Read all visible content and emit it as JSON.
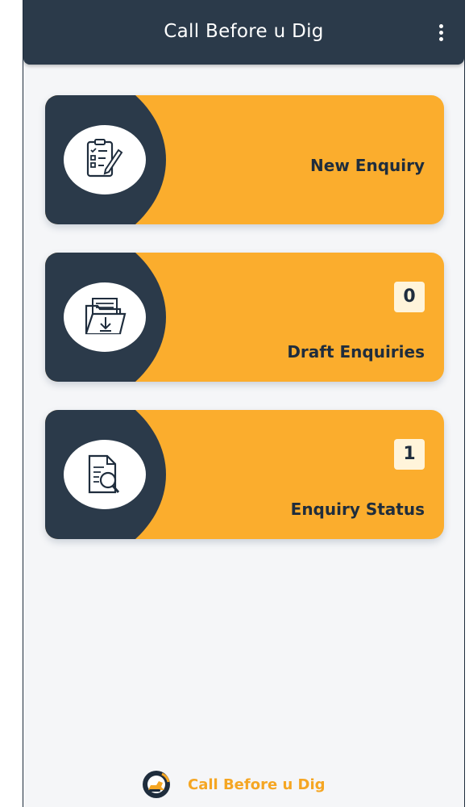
{
  "app": {
    "title": "Call Before u Dig",
    "menu_icon": "more-vertical-icon"
  },
  "colors": {
    "header": "#2b3a4a",
    "accent": "#fbad2d",
    "background": "#f5f6f8",
    "footer_text": "#f5a623"
  },
  "cards": [
    {
      "label": "New Enquiry",
      "icon": "checklist-pen-icon"
    },
    {
      "label": "Draft Enquiries",
      "count": "0",
      "icon": "folder-download-icon"
    },
    {
      "label": "Enquiry Status",
      "count": "1",
      "icon": "document-search-icon"
    }
  ],
  "footer": {
    "brand_text": "Call Before u Dig",
    "logo_icon": "excavator-logo-icon"
  }
}
